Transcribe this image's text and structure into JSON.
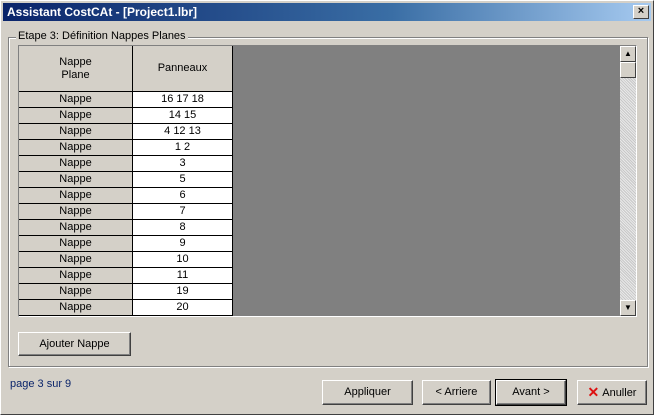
{
  "window": {
    "title": "Assistant CostCAt - [Project1.lbr]",
    "close_glyph": "×"
  },
  "group": {
    "label": "Etape 3: Définition Nappes Planes"
  },
  "grid": {
    "headers": {
      "col1_line1": "Nappe",
      "col1_line2": "Plane",
      "col2": "Panneaux"
    },
    "rows": [
      {
        "label": "Nappe",
        "panels": "16 17 18"
      },
      {
        "label": "Nappe",
        "panels": "14 15"
      },
      {
        "label": "Nappe",
        "panels": "4 12 13"
      },
      {
        "label": "Nappe",
        "panels": "1 2"
      },
      {
        "label": "Nappe",
        "panels": "3"
      },
      {
        "label": "Nappe",
        "panels": "5"
      },
      {
        "label": "Nappe",
        "panels": "6"
      },
      {
        "label": "Nappe",
        "panels": "7"
      },
      {
        "label": "Nappe",
        "panels": "8"
      },
      {
        "label": "Nappe",
        "panels": "9"
      },
      {
        "label": "Nappe",
        "panels": "10"
      },
      {
        "label": "Nappe",
        "panels": "11"
      },
      {
        "label": "Nappe",
        "panels": "19"
      },
      {
        "label": "Nappe",
        "panels": "20"
      }
    ]
  },
  "buttons": {
    "add": "Ajouter Nappe",
    "apply": "Appliquer",
    "back": "< Arriere",
    "next": "Avant >",
    "cancel": "Anuller"
  },
  "footer": {
    "page": "page 3 sur 9"
  },
  "icons": {
    "scroll_up": "up-arrow-icon",
    "scroll_down": "down-arrow-icon",
    "cancel": "x-icon"
  }
}
